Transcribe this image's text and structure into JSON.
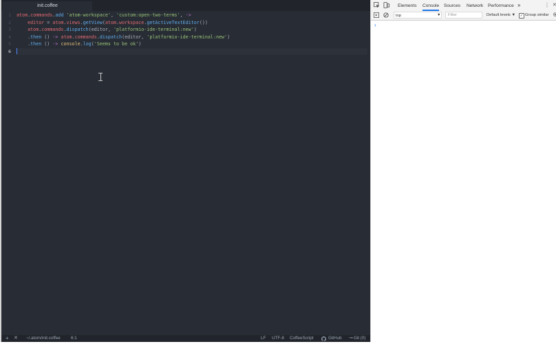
{
  "editor": {
    "tab_title": "init.coffee",
    "line_numbers": [
      "1",
      "2",
      "3",
      "4",
      "5",
      "6"
    ]
  },
  "status_bar": {
    "add_label": "+",
    "close_label": "✕",
    "file_path": "~/.atom/init.coffee",
    "cursor_position": "6:1",
    "line_ending": "LF",
    "encoding": "UTF-8",
    "grammar": "CoffeeScript",
    "github_label": "GitHub",
    "git_label": "Git (0)"
  },
  "devtools": {
    "tabs": [
      "Elements",
      "Console",
      "Sources",
      "Network",
      "Performance"
    ],
    "more_tabs": "»",
    "context": "top",
    "filter_placeholder": "Filter",
    "levels_label": "Default levels ▼",
    "group_similar_label": "Group similar",
    "group_similar_checked": "✓",
    "prompt_symbol": "›",
    "menu_icon": "⋮",
    "close_icon": "✕"
  },
  "colors": {
    "editor_bg": "#282c34",
    "devtools_accent": "#1a73e8"
  }
}
